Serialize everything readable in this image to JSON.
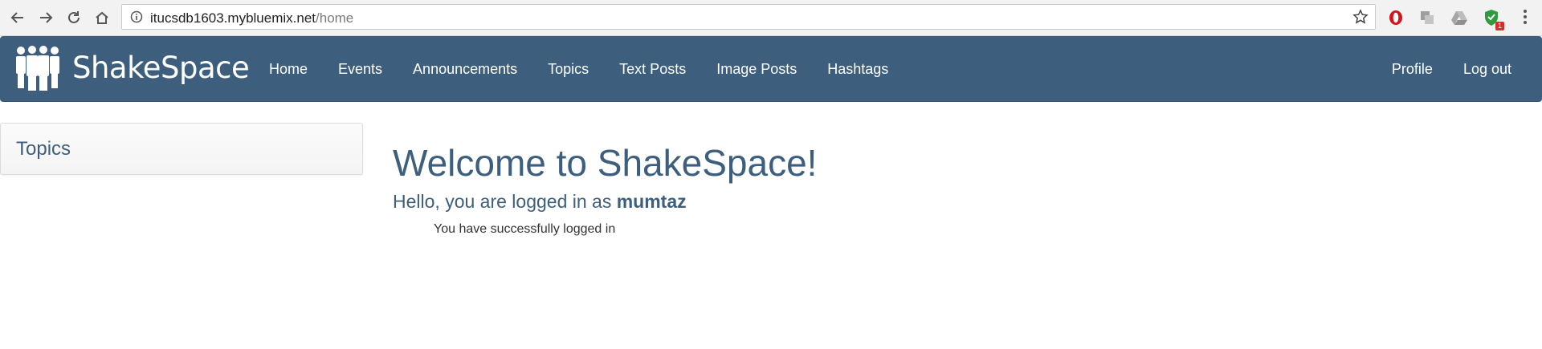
{
  "browser": {
    "url_host": "itucsdb1603.mybluemix.net",
    "url_path": "/home",
    "extension_badge": "1"
  },
  "navbar": {
    "brand": "ShakeSpace",
    "links": [
      "Home",
      "Events",
      "Announcements",
      "Topics",
      "Text Posts",
      "Image Posts",
      "Hashtags"
    ],
    "right_links": [
      "Profile",
      "Log out"
    ],
    "background_color": "#3d5f7d"
  },
  "sidebar": {
    "title": "Topics"
  },
  "main": {
    "welcome": "Welcome to ShakeSpace!",
    "hello_prefix": "Hello, you are logged in as",
    "username": "mumtaz",
    "message": "You have successfully logged in"
  }
}
